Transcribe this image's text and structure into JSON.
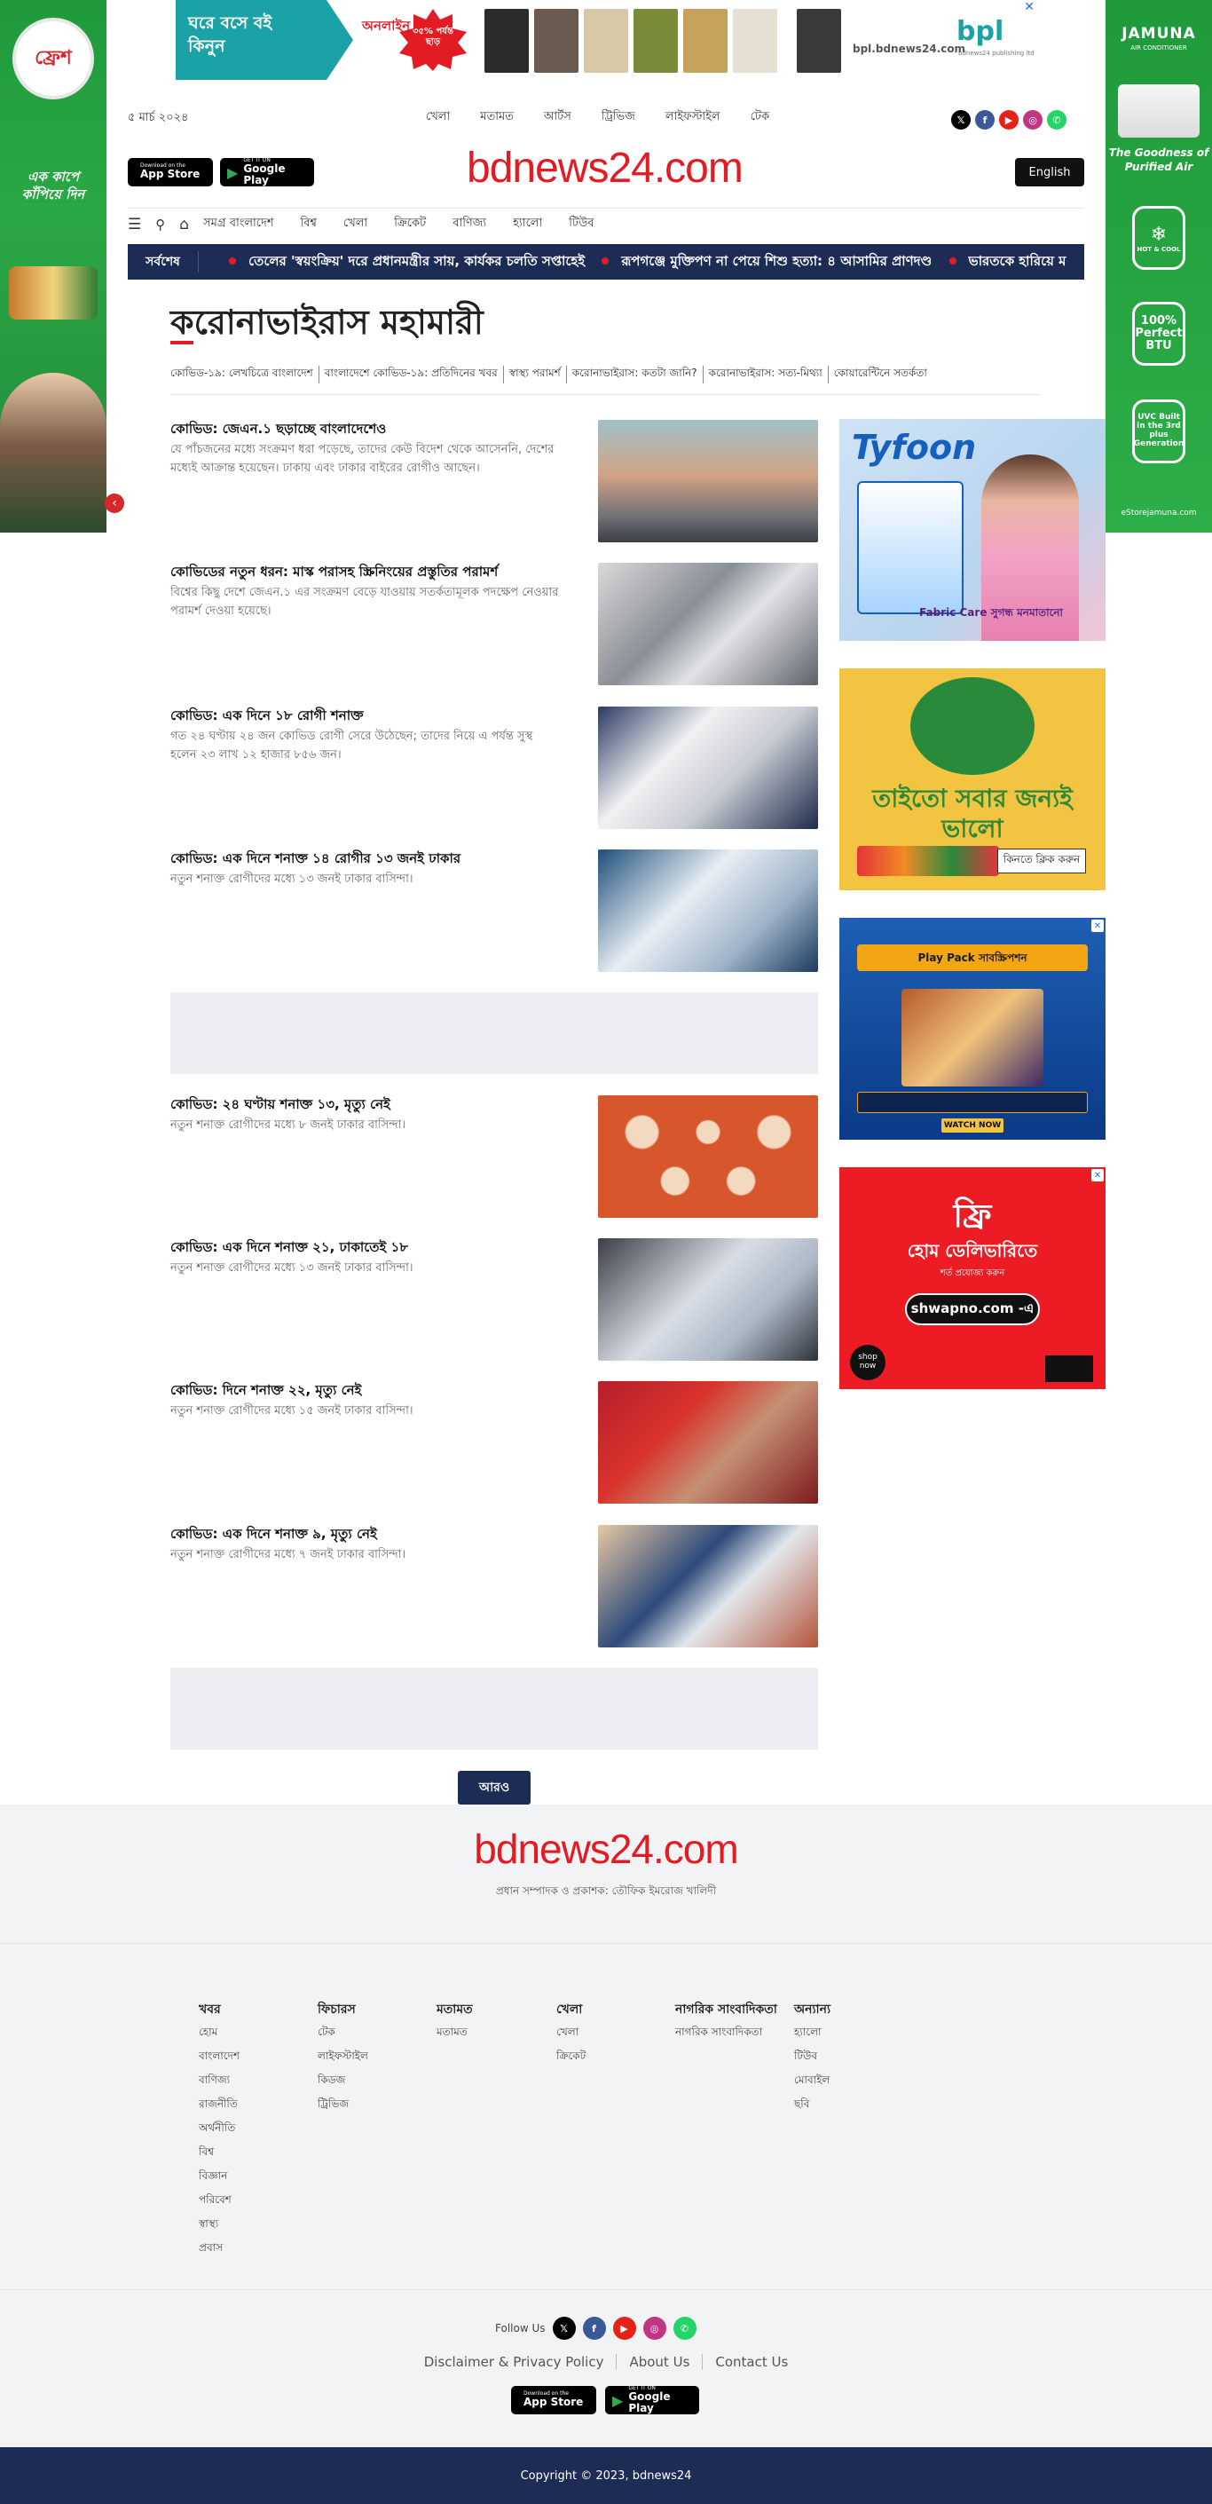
{
  "skin_left": {
    "brand": "ফ্রেশ",
    "tagline": "এক কাপে কাঁপিয়ে দিন"
  },
  "skin_right": {
    "brand": "JAMUNA",
    "brand_sub": "AIR CONDITIONER",
    "purified": "The Goodness of Purified Air",
    "badge_hotcool": "HOT & COOL",
    "badge_btu": "100% Perfect BTU",
    "badge_uvc": "UVC Built in the 3rd plus Generation",
    "store": "eStorejamuna.com"
  },
  "top_ad": {
    "headline": "ঘরে বসে বই কিনুন",
    "online": "অনলাইন অর্ডারে",
    "discount": "৩৫% পর্যন্ত ছাড়",
    "url": "bpl.bdnews24.com",
    "logo": "bpl",
    "logo_sub": "bdnews24 publishing ltd",
    "close": "✕",
    "book_colors": [
      "#2b2b2b",
      "#6a5b4e",
      "#d7c9a8",
      "#7a8c3a",
      "#c7a25a",
      "#e6e0d2",
      "#3a3a3a"
    ]
  },
  "header": {
    "date": "৫ মার্চ ২০২৪",
    "topnav": [
      "খেলা",
      "মতামত",
      "আর্টস",
      "ট্রিভিজ",
      "লাইফস্টাইল",
      "টেক"
    ],
    "logo": "bdnews24.com",
    "lang_button": "English",
    "app_store": {
      "small": "Download on the",
      "big": "App Store"
    },
    "google_play": {
      "small": "GET IT ON",
      "big": "Google Play"
    },
    "social": [
      {
        "name": "x",
        "glyph": "𝕏",
        "color": "#000000"
      },
      {
        "name": "facebook",
        "glyph": "f",
        "color": "#3b5998"
      },
      {
        "name": "youtube",
        "glyph": "▶",
        "color": "#e62117"
      },
      {
        "name": "instagram",
        "glyph": "◎",
        "color": "#c13584"
      },
      {
        "name": "whatsapp",
        "glyph": "✆",
        "color": "#25d366"
      }
    ]
  },
  "mainnav": {
    "items": [
      "সমগ্র বাংলাদেশ",
      "বিশ্ব",
      "খেলা",
      "ক্রিকেট",
      "বাণিজ্য",
      "হ্যালো",
      "টিউব"
    ]
  },
  "ticker": {
    "label": "সর্বশেষ",
    "items": [
      "তেলের 'স্বয়ংক্রিয়' দরে প্রধানমন্ত্রীর সায়, কার্যকর চলতি সপ্তাহেই",
      "রূপগঞ্জে মুক্তিপণ না পেয়ে শিশু হত্যা: ৪ আসামির প্রাণদণ্ড",
      "ভারতকে হারিয়ে ম"
    ]
  },
  "section": {
    "title": "করোনাভাইরাস মহামারী",
    "subnav": [
      "কোভিড-১৯: লেখচিত্রে বাংলাদেশ",
      "বাংলাদেশে কোভিড-১৯: প্রতিদিনের খবর",
      "স্বাস্থ্য পরামর্শ",
      "করোনাভাইরাস: কতটা জানি?",
      "করোনাভাইরাস: সত্য-মিথ্যা",
      "কোয়ারেন্টিনে সতর্কতা"
    ]
  },
  "stories": [
    {
      "title": "কোভিড: জেএন.১ ছড়াচ্ছে বাংলাদেশেও",
      "summary": "যে পাঁচজনের মধ্যে সংক্রমণ ধরা পড়েছে, তাদের কেউ বিদেশ থেকে আসেননি, দেশের মধ্যেই আক্রান্ত হয়েছেন। ঢাকায় এবং ঢাকার বাইরের রোগীও আছেন।"
    },
    {
      "title": "কোভিডের নতুন ধরন: মাস্ক পরাসহ স্ক্রিনিংয়ের প্রস্তুতির পরামর্শ",
      "summary": "বিশ্বের কিছু দেশে জেএন.১ এর সংক্রমণ বেড়ে যাওয়ায় সতর্কতামূলক পদক্ষেপ নেওয়ার পরামর্শ দেওয়া হয়েছে।"
    },
    {
      "title": "কোভিড: এক দিনে ১৮ রোগী শনাক্ত",
      "summary": "গত ২৪ ঘণ্টায় ২৪ জন কোভিড রোগী সেরে উঠেছেন; তাদের নিয়ে এ পর্যন্ত সুস্থ হলেন ২৩ লাখ ১২ হাজার ৮৫৬ জন।"
    },
    {
      "title": "কোভিড: এক দিনে শনাক্ত ১৪ রোগীর ১৩ জনই ঢাকার",
      "summary": "নতুন শনাক্ত রোগীদের মধ্যে ১৩ জনই ঢাকার বাসিন্দা।"
    },
    {
      "title": "কোভিড: ২৪ ঘণ্টায় শনাক্ত ১৩, মৃত্যু নেই",
      "summary": "নতুন শনাক্ত রোগীদের মধ্যে ৮ জনই ঢাকার বাসিন্দা।"
    },
    {
      "title": "কোভিড: এক দিনে শনাক্ত ২১, ঢাকাতেই ১৮",
      "summary": "নতুন শনাক্ত রোগীদের মধ্যে ১৩ জনই ঢাকার বাসিন্দা।"
    },
    {
      "title": "কোভিড: দিনে শনাক্ত ২২, মৃত্যু নেই",
      "summary": "নতুন শনাক্ত রোগীদের মধ্যে ১৫ জনই ঢাকার বাসিন্দা।"
    },
    {
      "title": "কোভিড: এক দিনে শনাক্ত ৯, মৃত্যু নেই",
      "summary": "নতুন শনাক্ত রোগীদের মধ্যে ৭ জনই ঢাকার বাসিন্দা।"
    }
  ],
  "more_button": "আরও",
  "right_ads": {
    "tyfoon": {
      "brand": "Tyfoon",
      "caption": "Fabric Care সুগন্ধ মনমাতানো"
    },
    "pran": {
      "text": "তাইতো সবার জন্যই ভালো",
      "cta": "কিনতে ক্লিক করুন"
    },
    "playpack": {
      "title": "Play Pack সাবস্ক্রিপশন",
      "watch": "WATCH NOW"
    },
    "shwapno": {
      "free": "ফ্রি",
      "home": "হোম ডেলিভারিতে",
      "cond": "শর্ত প্রযোজ্য করুন",
      "pill": "shwapno.com -এ",
      "shop": "shop now"
    }
  },
  "footer": {
    "logo": "bdnews24.com",
    "editor": "প্রধান সম্পাদক ও প্রকাশক: তৌফিক ইমরোজ খালিদী",
    "columns": [
      {
        "title": "খবর",
        "items": [
          "হোম",
          "বাংলাদেশ",
          "বাণিজ্য",
          "রাজনীতি",
          "অর্থনীতি",
          "বিশ্ব",
          "বিজ্ঞান",
          "পরিবেশ",
          "স্বাস্থ্য",
          "প্রবাস"
        ]
      },
      {
        "title": "ফিচারস",
        "items": [
          "টেক",
          "লাইফস্টাইল",
          "কিডজ",
          "ট্রিভিজ"
        ]
      },
      {
        "title": "মতামত",
        "items": [
          "মতামত"
        ]
      },
      {
        "title": "খেলা",
        "items": [
          "খেলা",
          "ক্রিকেট"
        ]
      },
      {
        "title": "নাগরিক সাংবাদিকতা",
        "items": [
          "নাগরিক সাংবাদিকতা"
        ]
      },
      {
        "title": "অন্যান্য",
        "items": [
          "হ্যালো",
          "টিউব",
          "মোবাইল",
          "ছবি"
        ]
      }
    ],
    "follow_label": "Follow Us",
    "links": [
      "Disclaimer & Privacy Policy",
      "About Us",
      "Contact Us"
    ],
    "copyright": "Copyright © 2023, bdnews24"
  }
}
